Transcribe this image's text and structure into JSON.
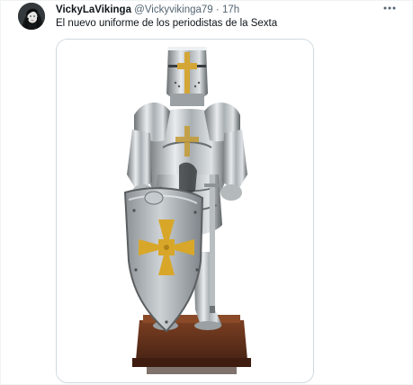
{
  "tweet": {
    "author_name": "VickyLaVikinga",
    "handle": "@Vickyvikinga79",
    "separator": "·",
    "time": "17h",
    "text": "El nuevo uniforme de los periodistas de la Sexta",
    "more_icon": "more-horizontal-icon",
    "avatar_icon": "avatar",
    "media_icon": "knight-armor-with-cross-shield"
  },
  "colors": {
    "primary_text": "#0f1419",
    "secondary_text": "#536471",
    "media_border": "#cfd9de",
    "cross_gold": "#d8a729"
  }
}
